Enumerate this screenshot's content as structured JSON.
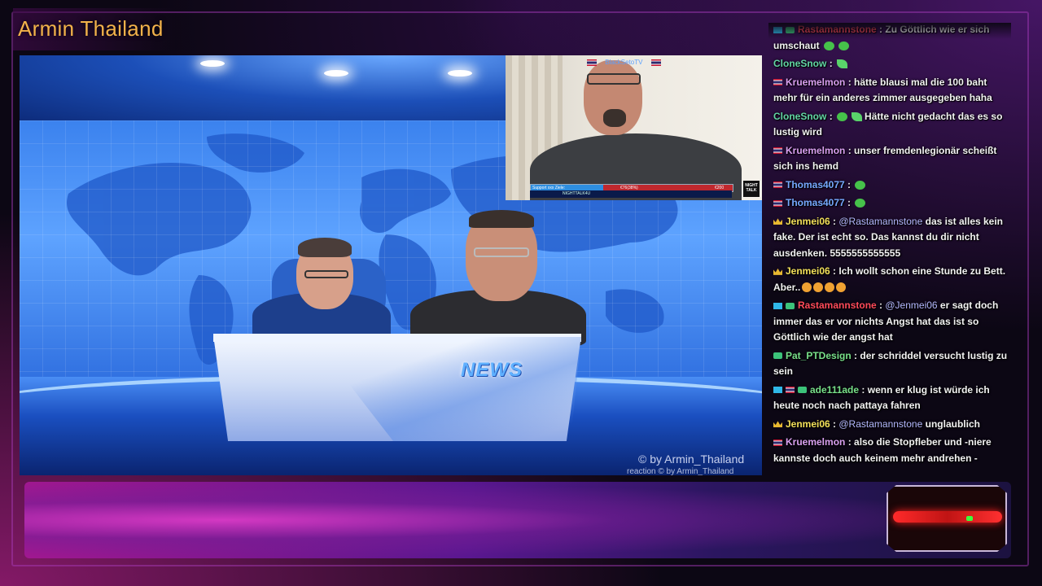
{
  "channel": {
    "title": "Armin Thailand"
  },
  "stage": {
    "desk_label": "NEWS",
    "watermark": "© by Armin_Thailand",
    "watermark_small": "reaction  © by Armin_Thailand"
  },
  "inset": {
    "stream_name": "BlackSetoTV",
    "donation_label": "Support xxx Ziele:",
    "donation_current": "€76(38%)",
    "donation_goal": "€200",
    "ticker": "NIGHTTALK4U",
    "logo": "NIGHT TALK"
  },
  "colors": {
    "accent": "#f2b24a",
    "chat_text": "#f2f2f2",
    "banner": "#a01890"
  },
  "chat": [
    {
      "badges": [
        "prime",
        "sub"
      ],
      "user": "Rastamannstone",
      "ucls": "u-red",
      "text": ": Zu Göttlich wie er sich umschaut",
      "emotes": [
        "emote",
        "emote"
      ]
    },
    {
      "badges": [],
      "user": "CloneSnow",
      "ucls": "u-teal",
      "text": ":",
      "emotes": [
        "leaf"
      ]
    },
    {
      "badges": [
        "flag"
      ],
      "user": "Kruemelmon",
      "ucls": "u-pink",
      "text": ": hätte blausi mal die 100 baht mehr für ein anderes zimmer ausgegeben haha",
      "emotes": []
    },
    {
      "badges": [],
      "user": "CloneSnow",
      "ucls": "u-teal",
      "text": ": Hätte nicht gedacht das es so lustig wird",
      "emotes_before": [
        "emote",
        "leaf"
      ]
    },
    {
      "badges": [
        "flag"
      ],
      "user": "Kruemelmon",
      "ucls": "u-pink",
      "text": ": unser fremdenlegionär scheißt sich ins hemd",
      "emotes": []
    },
    {
      "badges": [
        "flag"
      ],
      "user": "Thomas4077",
      "ucls": "u-blue",
      "text": ":",
      "emotes": [
        "emote"
      ]
    },
    {
      "badges": [
        "flag"
      ],
      "user": "Thomas4077",
      "ucls": "u-blue",
      "text": ":",
      "emotes": [
        "emote"
      ]
    },
    {
      "badges": [
        "crown"
      ],
      "user": "Jenmei06",
      "ucls": "u-yellow",
      "mention": "@Rastamannstone",
      "text": "das ist alles kein fake. Der ist echt so. Das kannst du dir nicht ausdenken. 5555555555555",
      "emotes": []
    },
    {
      "badges": [
        "crown"
      ],
      "user": "Jenmei06",
      "ucls": "u-yellow",
      "text": ": Ich wollt schon eine Stunde zu Bett. Aber..",
      "emotes": [
        "laugh",
        "laugh",
        "laugh",
        "laugh"
      ]
    },
    {
      "badges": [
        "prime",
        "sub"
      ],
      "user": "Rastamannstone",
      "ucls": "u-red",
      "mention": "@Jenmei06",
      "text": "er sagt doch immer das er vor nichts Angst hat das ist so Göttlich wie der angst hat",
      "emotes": []
    },
    {
      "badges": [
        "sub"
      ],
      "user": "Pat_PTDesign",
      "ucls": "u-green",
      "text": ": der schriddel versucht lustig zu sein",
      "emotes": []
    },
    {
      "badges": [
        "prime",
        "flag",
        "sub"
      ],
      "user": "ade111ade",
      "ucls": "u-green",
      "text": ": wenn er klug ist würde ich heute noch nach pattaya fahren",
      "emotes": []
    },
    {
      "badges": [
        "crown"
      ],
      "user": "Jenmei06",
      "ucls": "u-yellow",
      "mention": "@Rastamannstone",
      "text": "unglaublich",
      "emotes": []
    },
    {
      "badges": [
        "flag"
      ],
      "user": "Kruemelmon",
      "ucls": "u-pink",
      "text": ": also die Stopfleber und -niere kannste doch auch keinem mehr andrehen -",
      "emotes": []
    }
  ]
}
